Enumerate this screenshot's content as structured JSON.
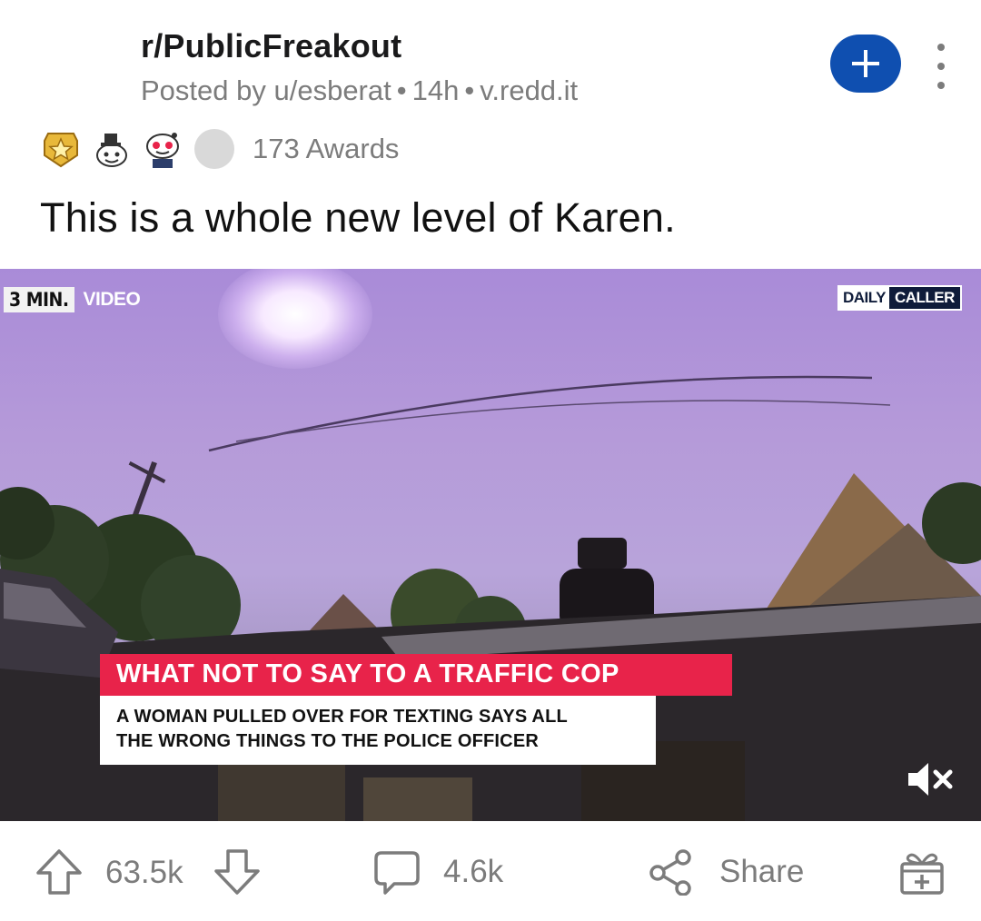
{
  "post": {
    "subreddit": "r/PublicFreakout",
    "posted_by": "Posted by u/esberat",
    "time": "14h",
    "domain": "v.redd.it",
    "awards_count": "173 Awards",
    "award_icons": [
      "gold-badge-icon",
      "wholesome-snoo-icon",
      "snoo-award-icon",
      "gray-award-icon"
    ],
    "title": "This is a whole new level of Karen."
  },
  "video": {
    "badge_left": "3 MIN.",
    "badge_right": "VIDEO",
    "logo_part1": "DAILY",
    "logo_part2": "CALLER",
    "chyron_headline": "WHAT NOT TO SAY TO A TRAFFIC COP",
    "chyron_line1": "A WOMAN PULLED OVER FOR TEXTING SAYS ALL",
    "chyron_line2": "THE WRONG THINGS TO THE POLICE OFFICER",
    "muted": true
  },
  "actions": {
    "upvotes": "63.5k",
    "comments": "4.6k",
    "share_label": "Share"
  },
  "colors": {
    "join_button": "#0f4fb0",
    "chyron_red": "#e8234a",
    "meta_gray": "#7c7c7c"
  }
}
